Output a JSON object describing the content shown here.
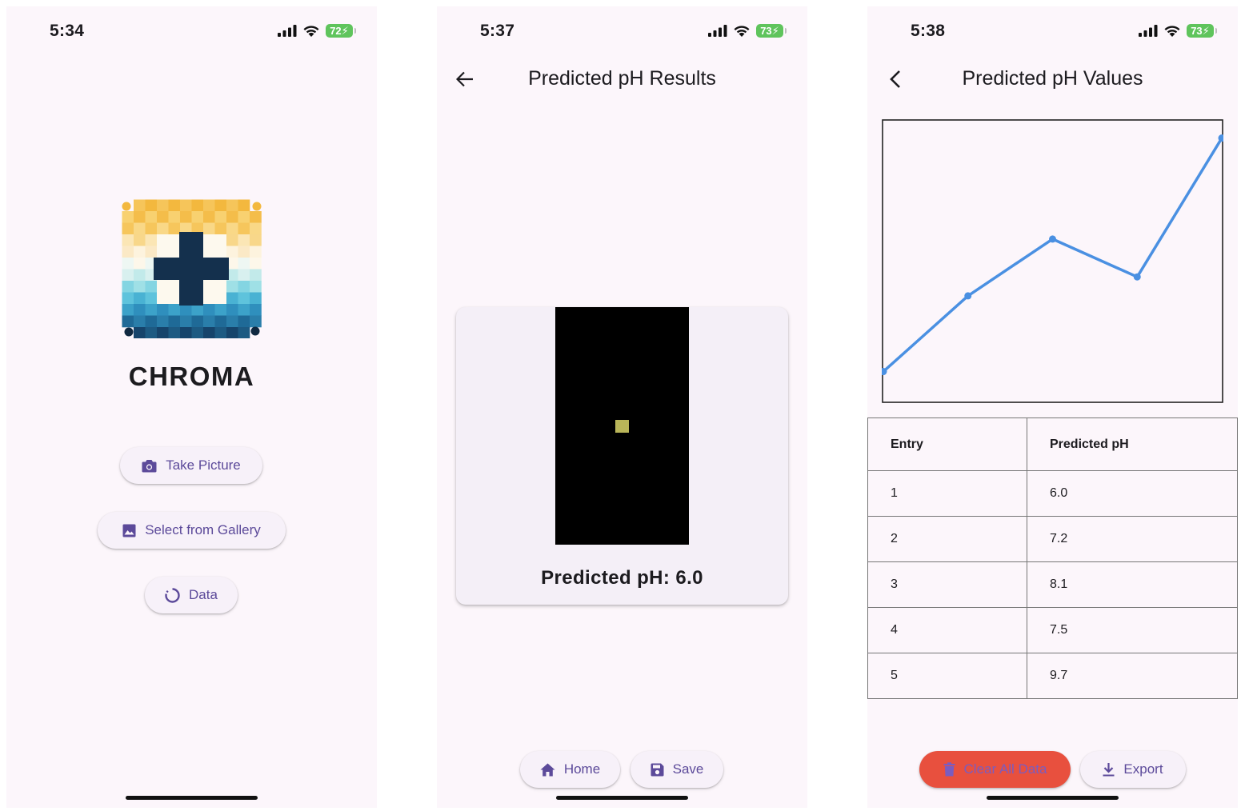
{
  "screen1": {
    "status": {
      "time": "5:34",
      "battery": "72"
    },
    "app_name": "CHROMA",
    "buttons": {
      "take_picture": "Take Picture",
      "select_gallery": "Select from Gallery",
      "data": "Data"
    }
  },
  "screen2": {
    "status": {
      "time": "5:37",
      "battery": "73"
    },
    "title": "Predicted pH Results",
    "result_text": "Predicted pH: 6.0",
    "sample_color": "#b9b559",
    "buttons": {
      "home": "Home",
      "save": "Save"
    }
  },
  "screen3": {
    "status": {
      "time": "5:38",
      "battery": "73"
    },
    "title": "Predicted pH Values",
    "table": {
      "headers": [
        "Entry",
        "Predicted pH"
      ],
      "rows": [
        [
          "1",
          "6.0"
        ],
        [
          "2",
          "7.2"
        ],
        [
          "3",
          "8.1"
        ],
        [
          "4",
          "7.5"
        ],
        [
          "5",
          "9.7"
        ]
      ]
    },
    "buttons": {
      "clear": "Clear All Data",
      "export": "Export"
    }
  },
  "colors": {
    "accent": "#5c4a9a",
    "background": "#fcf6fb",
    "danger": "#e8503e",
    "line": "#4a90e2",
    "battery": "#5fc45c"
  },
  "chart_data": {
    "type": "line",
    "x": [
      1,
      2,
      3,
      4,
      5
    ],
    "series": [
      {
        "values": [
          6.0,
          7.2,
          8.1,
          7.5,
          9.7
        ]
      }
    ],
    "ylim": [
      5.5,
      10.0
    ],
    "xlim": [
      1,
      5
    ],
    "grid": false,
    "legend": "none"
  }
}
